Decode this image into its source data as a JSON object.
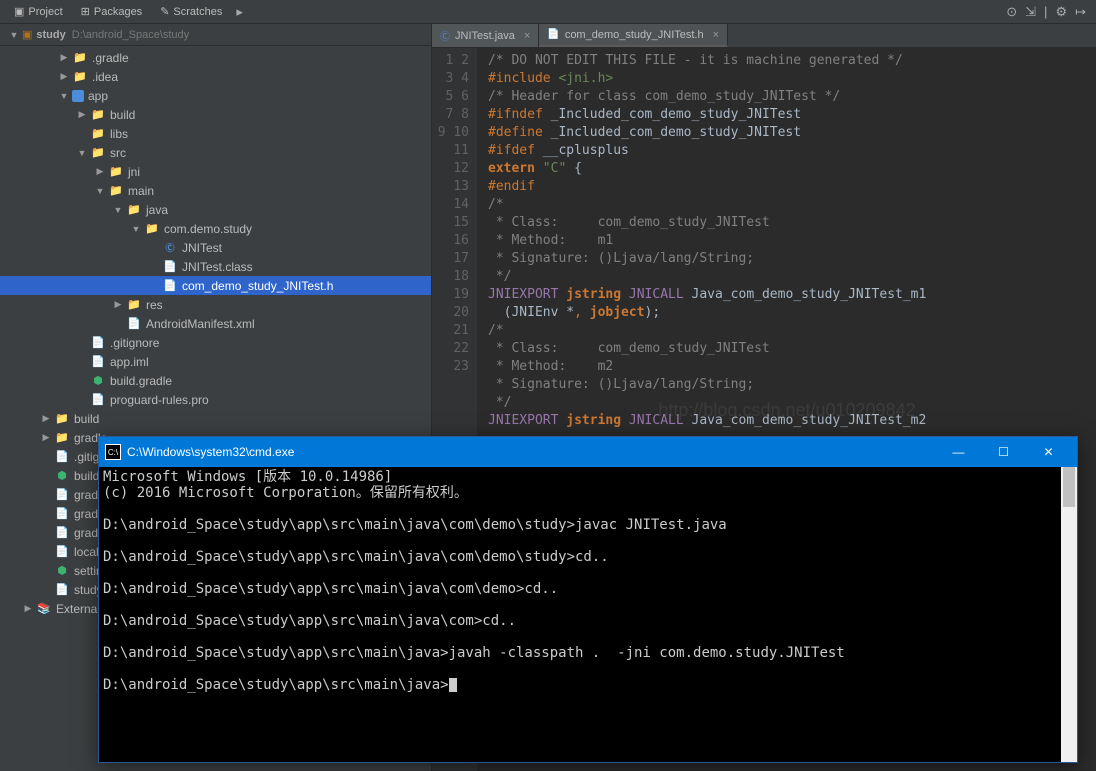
{
  "toolbar": {
    "tabs": [
      {
        "icon": "project-icon",
        "label": "Project"
      },
      {
        "icon": "packages-icon",
        "label": "Packages"
      },
      {
        "icon": "scratches-icon",
        "label": "Scratches"
      }
    ],
    "right_icons": [
      "target",
      "expand",
      "collapse",
      "gear",
      "hide"
    ]
  },
  "breadcrumb": {
    "project": "study",
    "path": "D:\\android_Space\\study"
  },
  "tree": [
    {
      "depth": 0,
      "toggle": "▶",
      "iconClass": "ic-folder-brown",
      "icon": "📁",
      "label": ".gradle",
      "type": "folder"
    },
    {
      "depth": 0,
      "toggle": "▶",
      "iconClass": "ic-folder-brown",
      "icon": "📁",
      "label": ".idea",
      "type": "folder"
    },
    {
      "depth": 0,
      "toggle": "▼",
      "iconClass": "ic-module",
      "icon": "",
      "label": "app",
      "type": "module"
    },
    {
      "depth": 1,
      "toggle": "▶",
      "iconClass": "ic-folder",
      "icon": "📁",
      "label": "build",
      "type": "folder"
    },
    {
      "depth": 1,
      "toggle": "",
      "iconClass": "ic-folder",
      "icon": "📁",
      "label": "libs",
      "type": "folder"
    },
    {
      "depth": 1,
      "toggle": "▼",
      "iconClass": "ic-folder",
      "icon": "📁",
      "label": "src",
      "type": "folder"
    },
    {
      "depth": 2,
      "toggle": "▶",
      "iconClass": "ic-folder",
      "icon": "📁",
      "label": "jni",
      "type": "folder"
    },
    {
      "depth": 2,
      "toggle": "▼",
      "iconClass": "ic-folder",
      "icon": "📁",
      "label": "main",
      "type": "folder"
    },
    {
      "depth": 3,
      "toggle": "▼",
      "iconClass": "ic-folder-blue",
      "icon": "📁",
      "label": "java",
      "type": "folder"
    },
    {
      "depth": 4,
      "toggle": "▼",
      "iconClass": "ic-folder",
      "icon": "📁",
      "label": "com.demo.study",
      "type": "package"
    },
    {
      "depth": 5,
      "toggle": "",
      "iconClass": "ic-java",
      "icon": "Ⓒ",
      "label": "JNITest",
      "type": "class"
    },
    {
      "depth": 5,
      "toggle": "",
      "iconClass": "ic-class",
      "icon": "📄",
      "label": "JNITest.class",
      "type": "file"
    },
    {
      "depth": 5,
      "toggle": "",
      "iconClass": "ic-header",
      "icon": "📄",
      "label": "com_demo_study_JNITest.h",
      "type": "header",
      "selected": true
    },
    {
      "depth": 3,
      "toggle": "▶",
      "iconClass": "ic-folder",
      "icon": "📁",
      "label": "res",
      "type": "folder"
    },
    {
      "depth": 3,
      "toggle": "",
      "iconClass": "ic-xml",
      "icon": "📄",
      "label": "AndroidManifest.xml",
      "type": "file"
    },
    {
      "depth": 1,
      "toggle": "",
      "iconClass": "ic-file",
      "icon": "📄",
      "label": ".gitignore",
      "type": "file"
    },
    {
      "depth": 1,
      "toggle": "",
      "iconClass": "ic-file",
      "icon": "📄",
      "label": "app.iml",
      "type": "file"
    },
    {
      "depth": 1,
      "toggle": "",
      "iconClass": "ic-gradle",
      "icon": "⬢",
      "label": "build.gradle",
      "type": "file"
    },
    {
      "depth": 1,
      "toggle": "",
      "iconClass": "ic-file",
      "icon": "📄",
      "label": "proguard-rules.pro",
      "type": "file"
    },
    {
      "depth": -1,
      "toggle": "▶",
      "iconClass": "ic-folder",
      "icon": "📁",
      "label": "build",
      "type": "folder"
    },
    {
      "depth": -1,
      "toggle": "▶",
      "iconClass": "ic-folder",
      "icon": "📁",
      "label": "gradle",
      "type": "folder"
    },
    {
      "depth": -1,
      "toggle": "",
      "iconClass": "ic-file",
      "icon": "📄",
      "label": ".gitignore",
      "type": "file",
      "cut": true
    },
    {
      "depth": -1,
      "toggle": "",
      "iconClass": "ic-gradle",
      "icon": "⬢",
      "label": "build.gradle",
      "type": "file",
      "cut": true
    },
    {
      "depth": -1,
      "toggle": "",
      "iconClass": "ic-prop",
      "icon": "📄",
      "label": "gradle.properties",
      "type": "file",
      "cut": true
    },
    {
      "depth": -1,
      "toggle": "",
      "iconClass": "ic-file",
      "icon": "📄",
      "label": "gradlew",
      "type": "file",
      "cut": true
    },
    {
      "depth": -1,
      "toggle": "",
      "iconClass": "ic-file",
      "icon": "📄",
      "label": "gradlew.bat",
      "type": "file",
      "cut": true
    },
    {
      "depth": -1,
      "toggle": "",
      "iconClass": "ic-prop",
      "icon": "📄",
      "label": "local.properties",
      "type": "file",
      "cut": true
    },
    {
      "depth": -1,
      "toggle": "",
      "iconClass": "ic-gradle",
      "icon": "⬢",
      "label": "settings.gradle",
      "type": "file",
      "cut": true
    },
    {
      "depth": -1,
      "toggle": "",
      "iconClass": "ic-file",
      "icon": "📄",
      "label": "study.iml",
      "type": "file",
      "cut": true
    },
    {
      "depth": -2,
      "toggle": "▶",
      "iconClass": "ic-prop",
      "icon": "📚",
      "label": "External Libraries",
      "type": "lib",
      "cut": true
    }
  ],
  "editor": {
    "tabs": [
      {
        "icon": "Ⓒ",
        "iconColor": "#4a8dd8",
        "label": "JNITest.java",
        "active": false
      },
      {
        "icon": "📄",
        "iconColor": "#a082bd",
        "label": "com_demo_study_JNITest.h",
        "active": true
      }
    ],
    "lines": [
      "/* DO NOT EDIT THIS FILE - it is machine generated */",
      "#include <jni.h>",
      "/* Header for class com_demo_study_JNITest */",
      "",
      "#ifndef _Included_com_demo_study_JNITest",
      "#define _Included_com_demo_study_JNITest",
      "#ifdef __cplusplus",
      "extern \"C\" {",
      "#endif",
      "/*",
      " * Class:     com_demo_study_JNITest",
      " * Method:    m1",
      " * Signature: ()Ljava/lang/String;",
      " */",
      "JNIEXPORT jstring JNICALL Java_com_demo_study_JNITest_m1",
      "  (JNIEnv *, jobject);",
      "",
      "/*",
      " * Class:     com_demo_study_JNITest",
      " * Method:    m2",
      " * Signature: ()Ljava/lang/String;",
      " */",
      "JNIEXPORT jstring JNICALL Java_com_demo_study_JNITest_m2"
    ]
  },
  "watermark": "http://blog.csdn.net/u010209842",
  "cmd": {
    "title": "C:\\Windows\\system32\\cmd.exe",
    "lines": [
      "Microsoft Windows [版本 10.0.14986]",
      "(c) 2016 Microsoft Corporation。保留所有权利。",
      "",
      "D:\\android_Space\\study\\app\\src\\main\\java\\com\\demo\\study>javac JNITest.java",
      "",
      "D:\\android_Space\\study\\app\\src\\main\\java\\com\\demo\\study>cd..",
      "",
      "D:\\android_Space\\study\\app\\src\\main\\java\\com\\demo>cd..",
      "",
      "D:\\android_Space\\study\\app\\src\\main\\java\\com>cd..",
      "",
      "D:\\android_Space\\study\\app\\src\\main\\java>javah -classpath .  -jni com.demo.study.JNITest",
      "",
      "D:\\android_Space\\study\\app\\src\\main\\java>"
    ]
  }
}
